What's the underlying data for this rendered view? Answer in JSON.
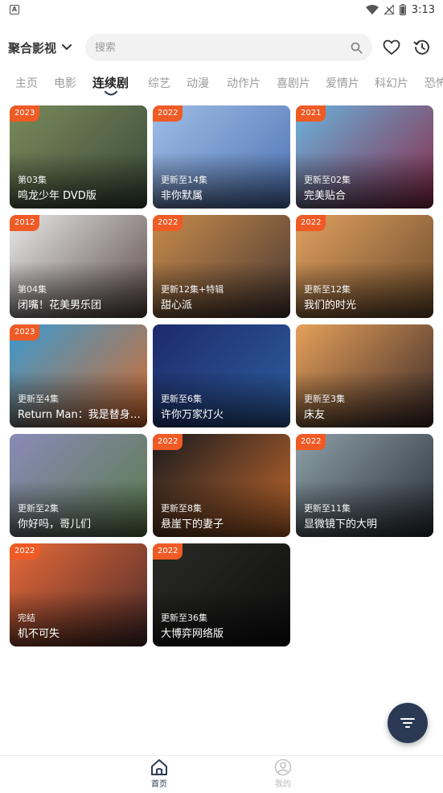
{
  "status_bar": {
    "app_letter": "A",
    "time": "3:13"
  },
  "header": {
    "brand": "聚合影视",
    "search_placeholder": "搜索"
  },
  "tabs": [
    {
      "label": "主页"
    },
    {
      "label": "电影"
    },
    {
      "label": "连续剧",
      "active": true
    },
    {
      "label": "综艺"
    },
    {
      "label": "动漫"
    },
    {
      "label": "动作片"
    },
    {
      "label": "喜剧片"
    },
    {
      "label": "爱情片"
    },
    {
      "label": "科幻片"
    },
    {
      "label": "恐怖"
    }
  ],
  "cards": [
    {
      "badge": "2023",
      "status": "第03集",
      "title": "鸣龙少年 DVD版",
      "colors": [
        "#7a8a5a",
        "#3a4a3a"
      ]
    },
    {
      "badge": "2022",
      "status": "更新至14集",
      "title": "非你默属",
      "colors": [
        "#9fbde6",
        "#4e73b3"
      ]
    },
    {
      "badge": "2021",
      "status": "更新至02集",
      "title": "完美贴合",
      "colors": [
        "#6ab2dc",
        "#8a2a4a"
      ]
    },
    {
      "badge": "2012",
      "status": "第04集",
      "title": "闭嘴！花美男乐团",
      "colors": [
        "#e8e8e8",
        "#5a4a4a"
      ]
    },
    {
      "badge": "2022",
      "status": "更新12集+特辑",
      "title": "甜心派",
      "colors": [
        "#c88a4a",
        "#4a3a34"
      ]
    },
    {
      "badge": "2022",
      "status": "更新至12集",
      "title": "我们的时光",
      "colors": [
        "#e0a060",
        "#6a4a2a"
      ]
    },
    {
      "badge": "2023",
      "status": "更新至4集",
      "title": "Return Man：我是替身协...",
      "colors": [
        "#3a9ad0",
        "#d86a2a"
      ]
    },
    {
      "badge": "",
      "status": "更新至6集",
      "title": "许你万家灯火",
      "colors": [
        "#1d2a6a",
        "#2e5fa0"
      ]
    },
    {
      "badge": "",
      "status": "更新至3集",
      "title": "床友",
      "colors": [
        "#e6a05a",
        "#3a2a28"
      ]
    },
    {
      "badge": "",
      "status": "更新至2集",
      "title": "你好吗，哥儿们",
      "colors": [
        "#8a8ab8",
        "#5a7a4a"
      ]
    },
    {
      "badge": "2022",
      "status": "更新至8集",
      "title": "悬崖下的妻子",
      "colors": [
        "#1a1a1e",
        "#c46a2e"
      ]
    },
    {
      "badge": "2022",
      "status": "更新至11集",
      "title": "显微镜下的大明",
      "colors": [
        "#8ea0a8",
        "#2a3038"
      ]
    },
    {
      "badge": "2022",
      "status": "完结",
      "title": "机不可失",
      "colors": [
        "#e86a3a",
        "#4a2a28"
      ]
    },
    {
      "badge": "2022",
      "status": "更新至36集",
      "title": "大博弈网络版",
      "colors": [
        "#2a2a28",
        "#0e0e0e"
      ]
    }
  ],
  "bottom_nav": [
    {
      "label": "首页",
      "active": true
    },
    {
      "label": "我的",
      "active": false
    }
  ],
  "colors": {
    "accent_badge": "#ef5a25",
    "fab": "#2b3954",
    "tab_active": "#222222",
    "tab_inactive": "#9b9b9b"
  }
}
